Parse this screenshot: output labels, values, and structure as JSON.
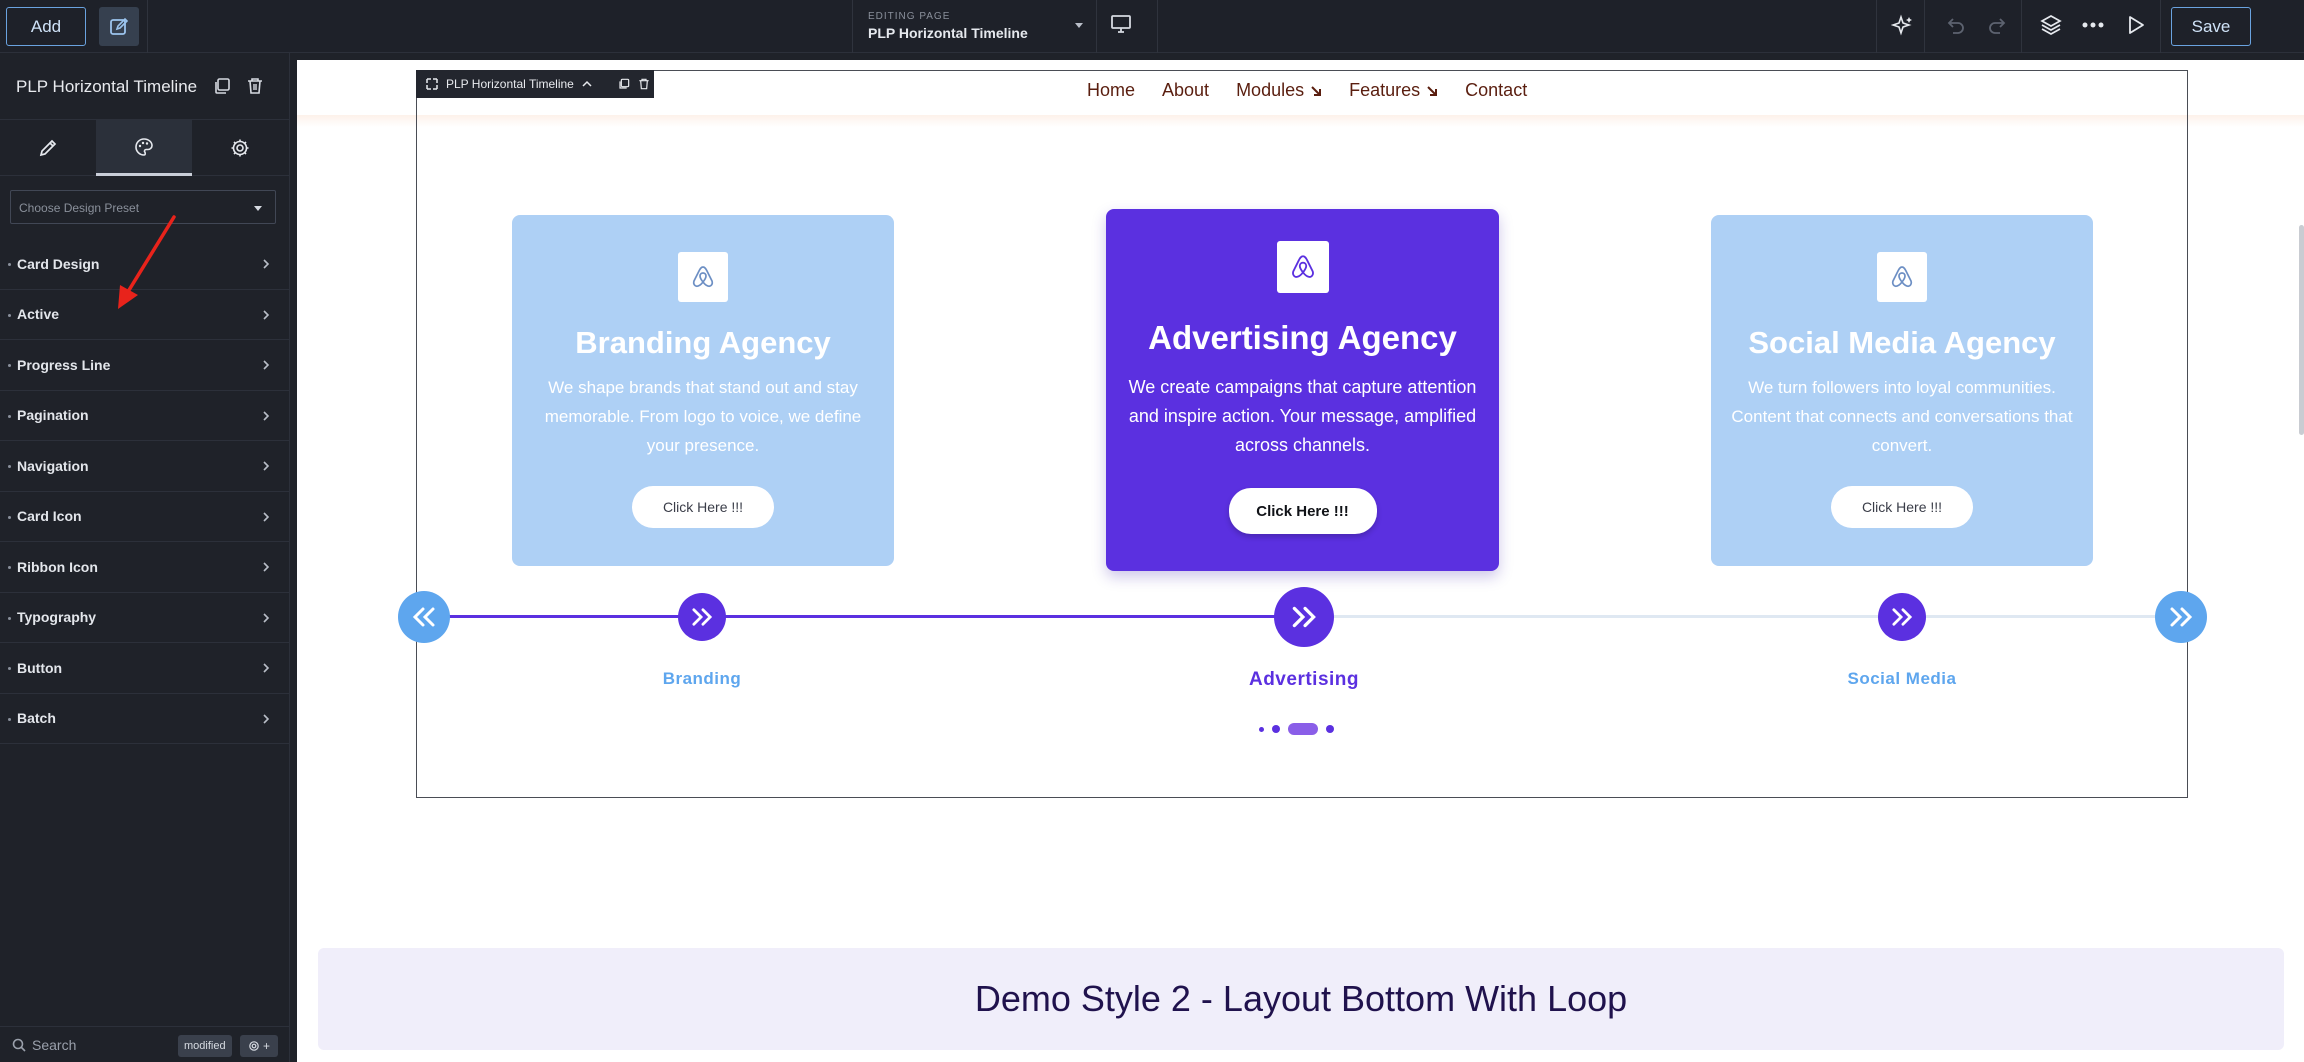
{
  "topbar": {
    "add_label": "Add",
    "editing_label": "EDITING PAGE",
    "page_name": "PLP Horizontal Timeline",
    "save_label": "Save",
    "icons": [
      "ai-sparkle-icon",
      "undo-icon",
      "redo-icon",
      "layers-icon",
      "more-icon",
      "play-icon",
      "desktop-icon"
    ]
  },
  "sidebar": {
    "title": "PLP Horizontal Timeline",
    "tabs": [
      "pencil-icon",
      "palette-icon",
      "gear-icon"
    ],
    "active_tab": 1,
    "preset_placeholder": "Choose Design Preset",
    "sections": [
      {
        "label": "Card Design"
      },
      {
        "label": "Active"
      },
      {
        "label": "Progress Line"
      },
      {
        "label": "Pagination"
      },
      {
        "label": "Navigation"
      },
      {
        "label": "Card Icon"
      },
      {
        "label": "Ribbon Icon"
      },
      {
        "label": "Typography"
      },
      {
        "label": "Button"
      },
      {
        "label": "Batch"
      }
    ],
    "search_label": "Search",
    "modified_label": "modified"
  },
  "canvas": {
    "widget_tag": "PLP Horizontal Timeline",
    "nav": {
      "items": [
        {
          "label": "Home",
          "has_arrow": false
        },
        {
          "label": "About",
          "has_arrow": false
        },
        {
          "label": "Modules",
          "has_arrow": true
        },
        {
          "label": "Features",
          "has_arrow": true
        },
        {
          "label": "Contact",
          "has_arrow": false
        }
      ]
    },
    "cards": [
      {
        "title": "Branding Agency",
        "text": "We shape brands that stand out and stay memorable. From logo to voice, we define your presence.",
        "button": "Click Here !!!",
        "timeline_label": "Branding",
        "active": false
      },
      {
        "title": "Advertising Agency",
        "text": "We create campaigns that capture attention and inspire action. Your message, amplified across channels.",
        "button": "Click Here !!!",
        "timeline_label": "Advertising",
        "active": true
      },
      {
        "title": "Social Media Agency",
        "text": "We turn followers into loyal communities. Content that connects and conversations that convert.",
        "button": "Click Here !!!",
        "timeline_label": "Social Media",
        "active": false
      }
    ],
    "pagination": {
      "count": 4,
      "active_index": 2
    },
    "demo_heading": "Demo Style 2 - Layout Bottom With Loop"
  },
  "colors": {
    "accent": "#5b30e0",
    "card_inactive": "#aed0f5",
    "nav_text": "#5a1e0f",
    "timeline_inactive_label": "#5ea6ee",
    "arrow_nav": "#5ea6ee"
  }
}
